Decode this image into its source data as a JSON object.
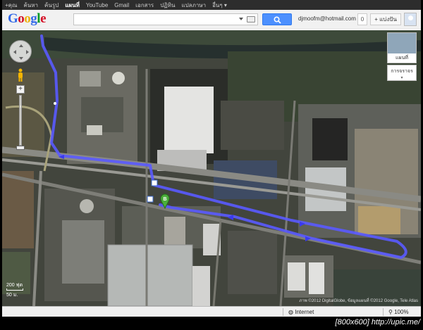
{
  "gbar": {
    "items": [
      {
        "label": "+คุณ",
        "active": false
      },
      {
        "label": "ค้นหา",
        "active": false
      },
      {
        "label": "ค้นรูป",
        "active": false
      },
      {
        "label": "แผนที่",
        "active": true
      },
      {
        "label": "YouTube",
        "active": false
      },
      {
        "label": "Gmail",
        "active": false
      },
      {
        "label": "เอกสาร",
        "active": false
      },
      {
        "label": "ปฏิทิน",
        "active": false
      },
      {
        "label": "แปลภาษา",
        "active": false
      },
      {
        "label": "อื่นๆ ▾",
        "active": false
      }
    ]
  },
  "header": {
    "logo_letters": [
      {
        "ch": "G",
        "color": "#3369e8"
      },
      {
        "ch": "o",
        "color": "#d50f25"
      },
      {
        "ch": "o",
        "color": "#eeb211"
      },
      {
        "ch": "g",
        "color": "#3369e8"
      },
      {
        "ch": "l",
        "color": "#009925"
      },
      {
        "ch": "e",
        "color": "#d50f25"
      }
    ],
    "search_value": "",
    "user_email": "djmoofm@hotmail.com",
    "notifications": "0",
    "share_label": "+ แบ่งปัน"
  },
  "map": {
    "map_type_label": "แผนที่",
    "traffic_label": "การจราจร",
    "marker_label": "B",
    "scale_top": "200 ฟุต",
    "scale_bottom": "50 ม.",
    "attribution": "ภาพ ©2012 DigitalGlobe, ข้อมูลแผนที่ ©2012 Google, Tele Atlas",
    "route_color": "#5a5aff"
  },
  "status": {
    "zone": "Internet",
    "zoom": "100%"
  },
  "caption": "[800x600] http://upic.me/"
}
